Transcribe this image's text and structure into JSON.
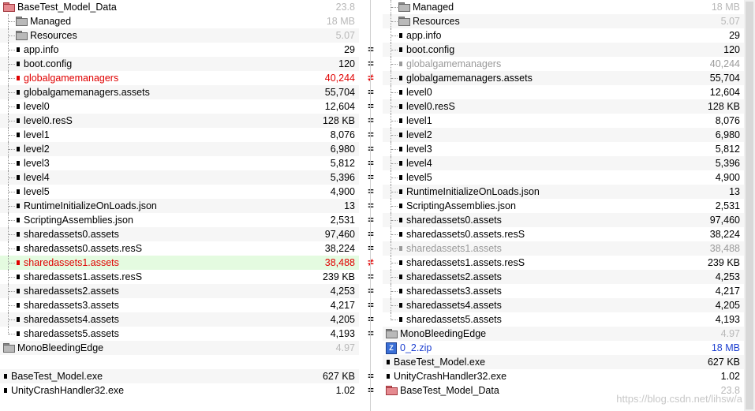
{
  "left": {
    "root": {
      "name": "BaseTest_Model_Data",
      "size": "23.8"
    },
    "items": [
      {
        "name": "Managed",
        "size": "18 MB",
        "type": "folder",
        "sizeStyle": "gray"
      },
      {
        "name": "Resources",
        "size": "5.07",
        "type": "folder",
        "sizeStyle": "gray"
      },
      {
        "name": "app.info",
        "size": "29",
        "type": "file"
      },
      {
        "name": "boot.config",
        "size": "120",
        "type": "file"
      },
      {
        "name": "globalgamemanagers",
        "size": "40,244",
        "type": "file",
        "style": "red"
      },
      {
        "name": "globalgamemanagers.assets",
        "size": "55,704",
        "type": "file"
      },
      {
        "name": "level0",
        "size": "12,604",
        "type": "file"
      },
      {
        "name": "level0.resS",
        "size": "128 KB",
        "type": "file"
      },
      {
        "name": "level1",
        "size": "8,076",
        "type": "file"
      },
      {
        "name": "level2",
        "size": "6,980",
        "type": "file"
      },
      {
        "name": "level3",
        "size": "5,812",
        "type": "file"
      },
      {
        "name": "level4",
        "size": "5,396",
        "type": "file"
      },
      {
        "name": "level5",
        "size": "4,900",
        "type": "file"
      },
      {
        "name": "RuntimeInitializeOnLoads.json",
        "size": "13",
        "type": "file"
      },
      {
        "name": "ScriptingAssemblies.json",
        "size": "2,531",
        "type": "file"
      },
      {
        "name": "sharedassets0.assets",
        "size": "97,460",
        "type": "file"
      },
      {
        "name": "sharedassets0.assets.resS",
        "size": "38,224",
        "type": "file"
      },
      {
        "name": "sharedassets1.assets",
        "size": "38,488",
        "type": "file",
        "style": "red",
        "highlight": true
      },
      {
        "name": "sharedassets1.assets.resS",
        "size": "239 KB",
        "type": "file"
      },
      {
        "name": "sharedassets2.assets",
        "size": "4,253",
        "type": "file"
      },
      {
        "name": "sharedassets3.assets",
        "size": "4,217",
        "type": "file"
      },
      {
        "name": "sharedassets4.assets",
        "size": "4,205",
        "type": "file"
      },
      {
        "name": "sharedassets5.assets",
        "size": "4,193",
        "type": "file"
      }
    ],
    "bottom": [
      {
        "name": "MonoBleedingEdge",
        "size": "4.97",
        "type": "folder",
        "sizeStyle": "gray"
      },
      {
        "name": "",
        "size": "",
        "type": "empty"
      },
      {
        "name": "BaseTest_Model.exe",
        "size": "627 KB",
        "type": "file"
      },
      {
        "name": "UnityCrashHandler32.exe",
        "size": "1.02",
        "type": "file"
      }
    ]
  },
  "right": {
    "root": {
      "name": "BaseTest_Model_Data",
      "size": "23.8"
    },
    "items": [
      {
        "name": "Managed",
        "size": "18 MB",
        "type": "folder",
        "sizeStyle": "gray"
      },
      {
        "name": "Resources",
        "size": "5.07",
        "type": "folder",
        "sizeStyle": "gray"
      },
      {
        "name": "app.info",
        "size": "29",
        "type": "file"
      },
      {
        "name": "boot.config",
        "size": "120",
        "type": "file"
      },
      {
        "name": "globalgamemanagers",
        "size": "40,244",
        "type": "file",
        "style": "faded"
      },
      {
        "name": "globalgamemanagers.assets",
        "size": "55,704",
        "type": "file"
      },
      {
        "name": "level0",
        "size": "12,604",
        "type": "file"
      },
      {
        "name": "level0.resS",
        "size": "128 KB",
        "type": "file"
      },
      {
        "name": "level1",
        "size": "8,076",
        "type": "file"
      },
      {
        "name": "level2",
        "size": "6,980",
        "type": "file"
      },
      {
        "name": "level3",
        "size": "5,812",
        "type": "file"
      },
      {
        "name": "level4",
        "size": "5,396",
        "type": "file"
      },
      {
        "name": "level5",
        "size": "4,900",
        "type": "file"
      },
      {
        "name": "RuntimeInitializeOnLoads.json",
        "size": "13",
        "type": "file"
      },
      {
        "name": "ScriptingAssemblies.json",
        "size": "2,531",
        "type": "file"
      },
      {
        "name": "sharedassets0.assets",
        "size": "97,460",
        "type": "file"
      },
      {
        "name": "sharedassets0.assets.resS",
        "size": "38,224",
        "type": "file"
      },
      {
        "name": "sharedassets1.assets",
        "size": "38,488",
        "type": "file",
        "style": "faded"
      },
      {
        "name": "sharedassets1.assets.resS",
        "size": "239 KB",
        "type": "file"
      },
      {
        "name": "sharedassets2.assets",
        "size": "4,253",
        "type": "file"
      },
      {
        "name": "sharedassets3.assets",
        "size": "4,217",
        "type": "file"
      },
      {
        "name": "sharedassets4.assets",
        "size": "4,205",
        "type": "file"
      },
      {
        "name": "sharedassets5.assets",
        "size": "4,193",
        "type": "file"
      }
    ],
    "bottom": [
      {
        "name": "MonoBleedingEdge",
        "size": "4.97",
        "type": "folder",
        "sizeStyle": "gray"
      },
      {
        "name": "0_2.zip",
        "size": "18 MB",
        "type": "zip",
        "style": "blue"
      },
      {
        "name": "BaseTest_Model.exe",
        "size": "627 KB",
        "type": "file"
      },
      {
        "name": "UnityCrashHandler32.exe",
        "size": "1.02",
        "type": "file"
      }
    ]
  },
  "compare_marks": [
    "",
    "",
    "",
    "=",
    "=",
    "≠",
    "=",
    "=",
    "=",
    "=",
    "=",
    "=",
    "=",
    "=",
    "=",
    "=",
    "=",
    "=",
    "≠",
    "=",
    "=",
    "=",
    "=",
    "=",
    "",
    "",
    "=",
    "="
  ],
  "icons": {
    "folder": "folder-icon",
    "file": "file-icon",
    "zip": "zip-icon"
  },
  "watermark": "https://blog.csdn.net/lihsw/a",
  "colors": {
    "diff_red": "#e00000",
    "highlight_green": "#e4fbe0",
    "zip_blue": "#1d3fd0"
  }
}
